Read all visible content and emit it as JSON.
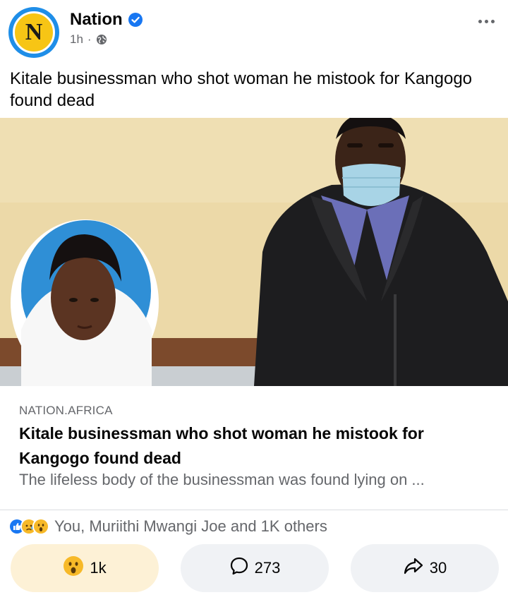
{
  "header": {
    "page_name": "Nation",
    "avatar_letter": "N",
    "time": "1h",
    "separator": "·"
  },
  "post": {
    "caption": "Kitale businessman who shot woman he mistook for Kangogo found dead"
  },
  "link": {
    "domain": "NATION.AFRICA",
    "title": "Kitale businessman who shot woman he mistook for Kangogo found dead",
    "description": "The lifeless body of the businessman was found lying on ..."
  },
  "reactions": {
    "summary": "You, Muriithi Mwangi Joe and 1K others",
    "icons": [
      "like-icon",
      "sad-icon",
      "wow-icon"
    ]
  },
  "actions": {
    "react_count": "1k",
    "comment_count": "273",
    "share_count": "30"
  },
  "colors": {
    "brand_blue": "#1877f2",
    "nation_yellow": "#f7c515",
    "secondary_text": "#65676b",
    "button_bg": "#f0f2f5",
    "reacted_bg": "#fdf1d6"
  }
}
